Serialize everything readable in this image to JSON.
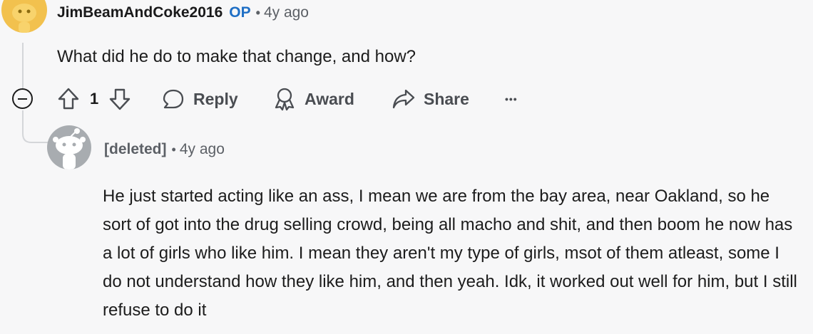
{
  "comment1": {
    "username": "JimBeamAndCoke2016",
    "op_badge": "OP",
    "separator": "•",
    "age": "4y ago",
    "body": "What did he do to make that change, and how?",
    "vote_count": "1",
    "actions": {
      "reply": "Reply",
      "award": "Award",
      "share": "Share",
      "more": "•••"
    },
    "icons": [
      "upvote-icon",
      "downvote-icon",
      "reply-icon",
      "award-icon",
      "share-icon",
      "more-icon",
      "collapse-icon"
    ]
  },
  "comment2": {
    "username": "[deleted]",
    "separator": "•",
    "age": "4y ago",
    "body": "He just started acting like an ass, I mean we are from the bay area, near Oakland, so he sort of got into the drug selling crowd, being all macho and shit, and then boom he now has a lot of girls who like him. I mean they aren't my type of girls, msot of them atleast, some I do not understand how they like him, and then yeah. Idk, it worked out well for him, but I still refuse to do it"
  },
  "colors": {
    "background": "#f7f7f8",
    "op": "#1f6fc5",
    "avatar1": "#f2c14e",
    "avatar2": "#a8acb0",
    "thread_line": "#d4d6d9"
  }
}
